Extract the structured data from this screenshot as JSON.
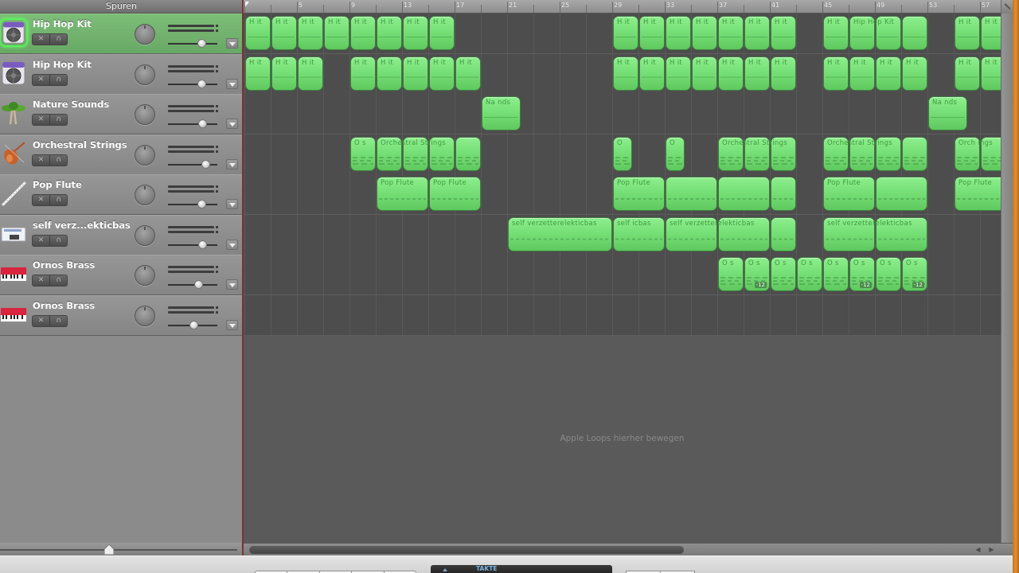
{
  "tracks_header": {
    "title": "Spuren"
  },
  "colors": {
    "selected_track": "#72b26f",
    "region": "#7ee07e",
    "region_border": "#3d7d3d",
    "divider": "#7a3434",
    "lcd_text": "#79b6e3"
  },
  "tracks": [
    {
      "name": "Hip Hop Kit",
      "icon": "drum-machine-icon",
      "selected": true,
      "volume": 0.67,
      "pan": 0,
      "mute_label": "✕",
      "solo_label": "∩"
    },
    {
      "name": "Hip Hop Kit",
      "icon": "drum-machine-icon",
      "selected": false,
      "volume": 0.67,
      "pan": 0,
      "mute_label": "✕",
      "solo_label": "∩"
    },
    {
      "name": "Nature Sounds",
      "icon": "palm-tree-icon",
      "selected": false,
      "volume": 0.69,
      "pan": 0,
      "mute_label": "✕",
      "solo_label": "∩"
    },
    {
      "name": "Orchestral Strings",
      "icon": "violin-icon",
      "selected": false,
      "volume": 0.75,
      "pan": 0,
      "mute_label": "✕",
      "solo_label": "∩"
    },
    {
      "name": "Pop Flute",
      "icon": "flute-icon",
      "selected": false,
      "volume": 0.67,
      "pan": 0,
      "mute_label": "✕",
      "solo_label": "∩"
    },
    {
      "name": "self verz...ekticbas",
      "icon": "synth-keyboard-icon",
      "selected": false,
      "volume": 0.69,
      "pan": 0,
      "mute_label": "✕",
      "solo_label": "∩"
    },
    {
      "name": "Ornos Brass",
      "icon": "red-keyboard-icon",
      "selected": false,
      "volume": 0.62,
      "pan": 0,
      "mute_label": "✕",
      "solo_label": "∩"
    },
    {
      "name": "Ornos Brass",
      "icon": "red-keyboard-icon",
      "selected": false,
      "volume": 0.52,
      "pan": 0,
      "mute_label": "✕",
      "solo_label": "∩"
    }
  ],
  "ruler": {
    "first_bar": 1,
    "visible_bars": 58,
    "labels": [
      "5",
      "9",
      "13",
      "17",
      "21",
      "25",
      "29",
      "33",
      "37",
      "41",
      "45",
      "49",
      "53",
      "57"
    ],
    "label_bars": [
      5,
      9,
      13,
      17,
      21,
      25,
      29,
      33,
      37,
      41,
      45,
      49,
      53,
      57
    ],
    "playhead_bar": 1
  },
  "lanes": [
    {
      "style": "drum",
      "regions": [
        {
          "start": 1,
          "length": 2,
          "label": "H   it"
        },
        {
          "start": 3,
          "length": 2,
          "label": "H   it"
        },
        {
          "start": 5,
          "length": 2,
          "label": "H   it"
        },
        {
          "start": 7,
          "length": 2,
          "label": "H   it"
        },
        {
          "start": 9,
          "length": 2,
          "label": "H   it"
        },
        {
          "start": 11,
          "length": 2,
          "label": "H   it"
        },
        {
          "start": 13,
          "length": 2,
          "label": "H   it"
        },
        {
          "start": 15,
          "length": 2,
          "label": "H   it"
        },
        {
          "start": 29,
          "length": 2,
          "label": "H   it"
        },
        {
          "start": 31,
          "length": 2,
          "label": "H   it"
        },
        {
          "start": 33,
          "length": 2,
          "label": "H   it"
        },
        {
          "start": 35,
          "length": 2,
          "label": "H   it"
        },
        {
          "start": 37,
          "length": 2,
          "label": "H   it"
        },
        {
          "start": 39,
          "length": 2,
          "label": "H   it"
        },
        {
          "start": 41,
          "length": 2,
          "label": "H   it"
        },
        {
          "start": 45,
          "length": 2,
          "label": "H   it"
        },
        {
          "start": 47,
          "length": 2,
          "label": "Hip Hop Kit"
        },
        {
          "start": 49,
          "length": 2,
          "label": ""
        },
        {
          "start": 51,
          "length": 2,
          "label": ""
        },
        {
          "start": 55,
          "length": 2,
          "label": "H   it"
        },
        {
          "start": 57,
          "length": 2,
          "label": "H   it"
        }
      ]
    },
    {
      "style": "drum",
      "regions": [
        {
          "start": 1,
          "length": 2,
          "label": "H   it"
        },
        {
          "start": 3,
          "length": 2,
          "label": "H   it"
        },
        {
          "start": 5,
          "length": 2,
          "label": "H   it"
        },
        {
          "start": 9,
          "length": 2,
          "label": "H   it"
        },
        {
          "start": 11,
          "length": 2,
          "label": "H   it"
        },
        {
          "start": 13,
          "length": 2,
          "label": "H   it"
        },
        {
          "start": 15,
          "length": 2,
          "label": "H   it"
        },
        {
          "start": 17,
          "length": 2,
          "label": "H   it"
        },
        {
          "start": 29,
          "length": 2,
          "label": "H   it"
        },
        {
          "start": 31,
          "length": 2,
          "label": "H   it"
        },
        {
          "start": 33,
          "length": 2,
          "label": "H   it"
        },
        {
          "start": 35,
          "length": 2,
          "label": "H   it"
        },
        {
          "start": 37,
          "length": 2,
          "label": "H   it"
        },
        {
          "start": 39,
          "length": 2,
          "label": "H   it"
        },
        {
          "start": 41,
          "length": 2,
          "label": "H   it"
        },
        {
          "start": 45,
          "length": 2,
          "label": "H   it"
        },
        {
          "start": 47,
          "length": 2,
          "label": "H   it"
        },
        {
          "start": 49,
          "length": 2,
          "label": "H   it"
        },
        {
          "start": 51,
          "length": 2,
          "label": "H   it"
        },
        {
          "start": 55,
          "length": 2,
          "label": "H   it"
        },
        {
          "start": 57,
          "length": 2,
          "label": "H   it"
        }
      ]
    },
    {
      "style": "drum",
      "regions": [
        {
          "start": 19,
          "length": 3,
          "label": "Na   nds"
        },
        {
          "start": 53,
          "length": 3,
          "label": "Na   nds"
        }
      ]
    },
    {
      "style": "multi",
      "regions": [
        {
          "start": 9,
          "length": 2,
          "label": "O   s"
        },
        {
          "start": 11,
          "length": 2,
          "label": "Orchestral Strings"
        },
        {
          "start": 13,
          "length": 2,
          "label": ""
        },
        {
          "start": 15,
          "length": 2,
          "label": ""
        },
        {
          "start": 17,
          "length": 2,
          "label": ""
        },
        {
          "start": 29,
          "length": 1.5,
          "label": "O"
        },
        {
          "start": 33,
          "length": 1.5,
          "label": "O"
        },
        {
          "start": 37,
          "length": 2,
          "label": "Orchestral Strings"
        },
        {
          "start": 39,
          "length": 2,
          "label": ""
        },
        {
          "start": 41,
          "length": 2,
          "label": ""
        },
        {
          "start": 45,
          "length": 2,
          "label": "Orchestral Strings"
        },
        {
          "start": 47,
          "length": 2,
          "label": ""
        },
        {
          "start": 49,
          "length": 2,
          "label": ""
        },
        {
          "start": 51,
          "length": 2,
          "label": ""
        },
        {
          "start": 55,
          "length": 2,
          "label": "Orch   ings"
        },
        {
          "start": 57,
          "length": 2,
          "label": ""
        }
      ]
    },
    {
      "style": "melody",
      "regions": [
        {
          "start": 11,
          "length": 4,
          "label": "Pop Flute"
        },
        {
          "start": 15,
          "length": 4,
          "label": "Pop Flute"
        },
        {
          "start": 29,
          "length": 4,
          "label": "Pop Flute"
        },
        {
          "start": 33,
          "length": 4,
          "label": ""
        },
        {
          "start": 37,
          "length": 4,
          "label": ""
        },
        {
          "start": 41,
          "length": 2,
          "label": ""
        },
        {
          "start": 45,
          "length": 4,
          "label": "Pop Flute"
        },
        {
          "start": 49,
          "length": 4,
          "label": ""
        },
        {
          "start": 55,
          "length": 4,
          "label": "Pop Flute"
        }
      ]
    },
    {
      "style": "melody",
      "regions": [
        {
          "start": 21,
          "length": 8,
          "label": "self verzetterelekticbas"
        },
        {
          "start": 29,
          "length": 4,
          "label": "self     icbas"
        },
        {
          "start": 33,
          "length": 4,
          "label": "self verzetterelekticbas"
        },
        {
          "start": 37,
          "length": 4,
          "label": ""
        },
        {
          "start": 41,
          "length": 2,
          "label": ""
        },
        {
          "start": 45,
          "length": 4,
          "label": "self verzetterelekticbas"
        },
        {
          "start": 49,
          "length": 4,
          "label": ""
        }
      ]
    },
    {
      "style": "multi",
      "regions": [
        {
          "start": 37,
          "length": 2,
          "label": "O   s"
        },
        {
          "start": 39,
          "length": 2,
          "label": "O   s",
          "badge": "-12"
        },
        {
          "start": 41,
          "length": 2,
          "label": "O   s"
        },
        {
          "start": 43,
          "length": 2,
          "label": "O   s"
        },
        {
          "start": 45,
          "length": 2,
          "label": "O   s"
        },
        {
          "start": 47,
          "length": 2,
          "label": "O   s",
          "badge": "-12"
        },
        {
          "start": 49,
          "length": 2,
          "label": "O   s"
        },
        {
          "start": 51,
          "length": 2,
          "label": "O   s",
          "badge": "-12"
        }
      ]
    },
    {
      "style": "multi",
      "regions": []
    }
  ],
  "arrange": {
    "drop_hint": "Apple Loops hierher bewegen"
  },
  "scroll": {
    "horizontal_left": "◀",
    "horizontal_right": "▶"
  },
  "toolbar": {
    "lcd_mode": "TAKTE"
  }
}
